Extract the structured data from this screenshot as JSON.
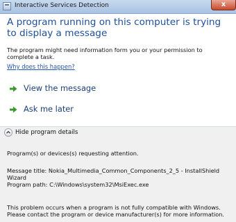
{
  "window": {
    "title": "Interactive Services Detection",
    "close_label": "x"
  },
  "main": {
    "headline": "A program running on this computer is trying to display a message",
    "description": "The program might need information form you or your permission to complete a task.",
    "why_link": "Why does this happen?",
    "options": [
      {
        "label": "View the message",
        "icon": "green-arrow-icon"
      },
      {
        "label": "Ask me later",
        "icon": "green-arrow-icon"
      }
    ]
  },
  "details": {
    "toggle_label": "Hide program details",
    "toggle_icon": "chevron-up-icon",
    "attention_text": "Program(s) or devices(s) requesting attention.",
    "message_title_line": "Message title:  Nokia_Multimedia_Common_Components_2_5 - InstallShield",
    "message_title_cont": "Wizard",
    "program_path_line": "Program path:  C:\\Windows\\system32\\MsiExec.exe",
    "compat_text": "This problem occurs when a program is not fully compatible with Windows. Please contact the program or device manufacturer(s) for more information."
  },
  "colors": {
    "headline": "#1e4f9c",
    "link": "#1f55b0",
    "arrow": "#3a9a2c",
    "lower_bg": "#f0f0f0"
  }
}
